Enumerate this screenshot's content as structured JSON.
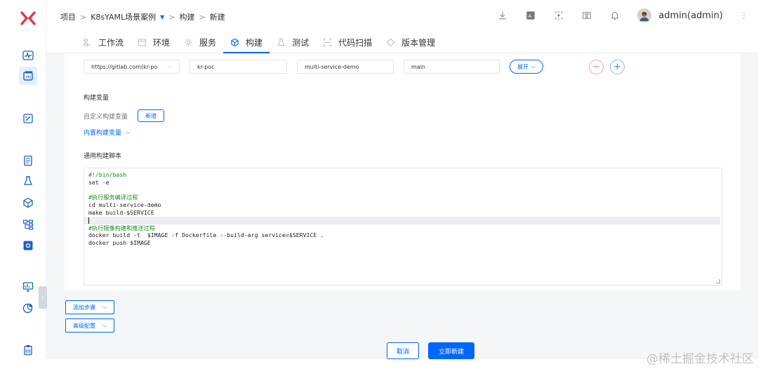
{
  "breadcrumb": {
    "project": "项目",
    "case": "K8sYAML场景案例",
    "section": "构建",
    "page": "新建"
  },
  "user": {
    "name": "admin(admin)"
  },
  "tabs": [
    {
      "label": "工作流",
      "icon": "workflow-icon"
    },
    {
      "label": "环境",
      "icon": "environment-icon"
    },
    {
      "label": "服务",
      "icon": "service-icon"
    },
    {
      "label": "构建",
      "icon": "build-icon",
      "active": true
    },
    {
      "label": "测试",
      "icon": "test-icon"
    },
    {
      "label": "代码扫描",
      "icon": "scan-icon"
    },
    {
      "label": "版本管理",
      "icon": "version-icon"
    }
  ],
  "repo": {
    "url": "https://gitlab.com(kr-po",
    "namespace": "kr-poc",
    "repository": "multi-service-demo",
    "branch": "main",
    "expand_label": "展开"
  },
  "build_vars": {
    "title": "构建变量",
    "custom_label": "自定义构建变量",
    "add_label": "新增",
    "builtin_label": "内置构建变量"
  },
  "script": {
    "title": "通用构建脚本",
    "lines": [
      {
        "text": "#!/bin/bash",
        "type": "comment"
      },
      {
        "text": "set -e",
        "type": "code"
      },
      {
        "text": "",
        "type": "code"
      },
      {
        "text": "#执行服务编译过程",
        "type": "comment"
      },
      {
        "text": "cd multi-service-demo",
        "type": "code"
      },
      {
        "text": "make build-$SERVICE",
        "type": "code"
      },
      {
        "text": "",
        "type": "cursor"
      },
      {
        "text": "#执行镜像构建和推送过程",
        "type": "comment"
      },
      {
        "text": "docker build -t  $IMAGE -f Dockerfile --build-arg service=$SERVICE .",
        "type": "code"
      },
      {
        "text": "docker push $IMAGE",
        "type": "code"
      }
    ]
  },
  "actions": {
    "add_step": "添加步骤",
    "advanced": "高级配置",
    "cancel": "取消",
    "create": "立即新建"
  },
  "watermark": "@稀土掘金技术社区",
  "colors": {
    "accent": "#0066ff",
    "logo": "#e8344e"
  }
}
